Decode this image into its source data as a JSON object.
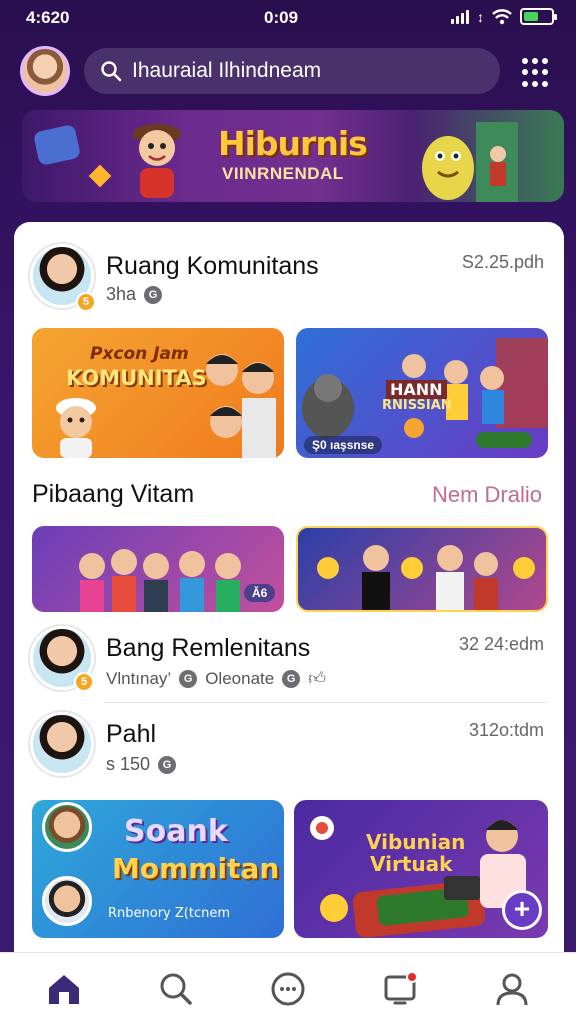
{
  "status": {
    "time_left": "4:620",
    "time_center": "0:09",
    "battery_level": 0.55
  },
  "header": {
    "search_placeholder": "Ihauraial Ilhindneam"
  },
  "banner": {
    "title": "Hiburnis",
    "subtitle": "VIINRNENDAL"
  },
  "posts": [
    {
      "name": "Ruang Komunitans",
      "sub": "3ha",
      "time": "S2.25.pdh"
    },
    {
      "name": "Bang Remlenitans",
      "sub": "Vlntınay’",
      "sub2": "Oleonate",
      "time": "32 24:edm"
    },
    {
      "name": "Pahl",
      "sub": "ѕ 150",
      "time": "312o:tdm"
    }
  ],
  "cards": {
    "card1": {
      "line1": "Pxcon Jam",
      "line2": "KOMUNITAS"
    },
    "card2": {
      "line1": "HANN",
      "line2": "RNISSIAN",
      "footer": "Ş0 ıaşsnse"
    },
    "card3": {
      "tag": "Ǎ6"
    },
    "card5": {
      "line1": "Soank",
      "line2": "Mommitan",
      "footer": "Rnbenory Z(tcnem"
    },
    "card6": {
      "line1": "Vibunian",
      "line2": "Virtuak"
    }
  },
  "section": {
    "title": "Pibaang Vitam",
    "link": "Nem Dralio"
  },
  "colors": {
    "accent": "#6a3bc4",
    "background": "#2a0f4f",
    "notification": "#e32b2b"
  },
  "tabbar": {
    "items": [
      "home-icon",
      "search-icon",
      "chat-icon",
      "notifications-icon",
      "profile-icon"
    ]
  }
}
